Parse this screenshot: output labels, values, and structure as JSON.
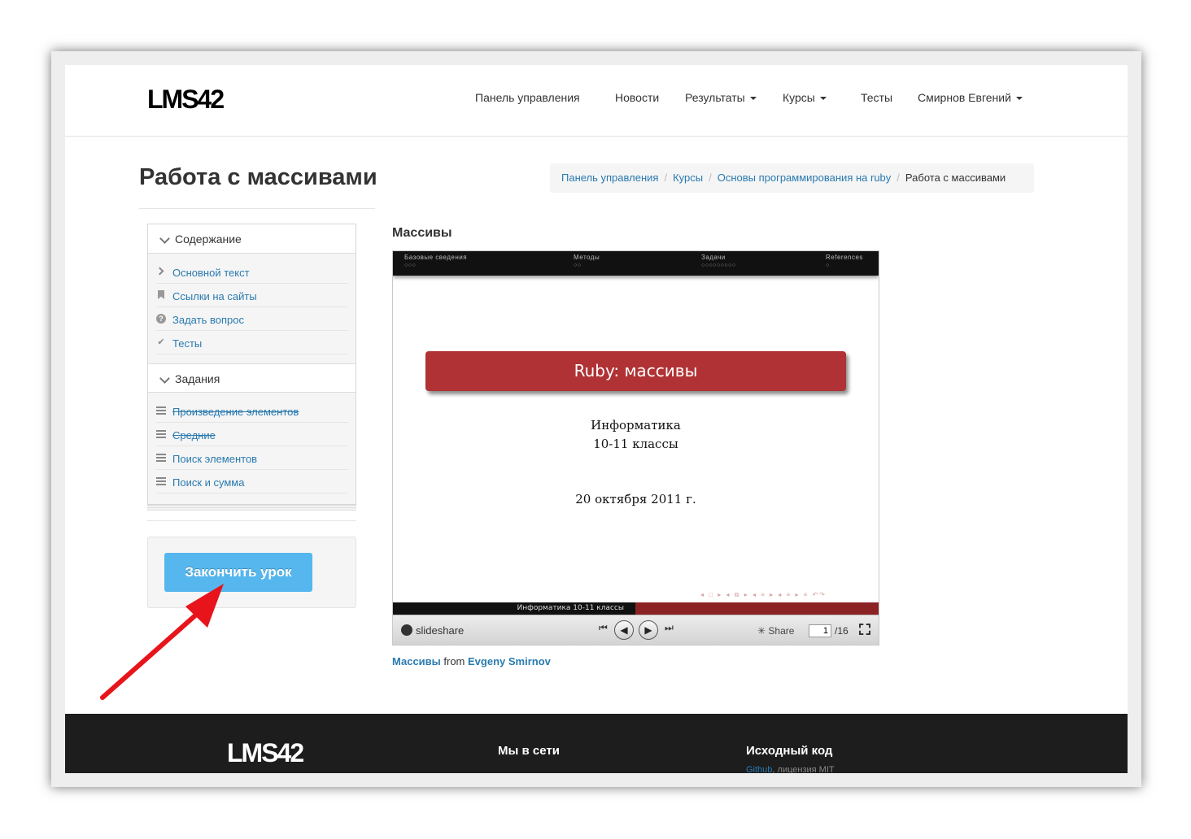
{
  "navbar": {
    "brand": "LMS42",
    "items": [
      {
        "label": "Панель управления",
        "dropdown": false
      },
      {
        "label": "Новости",
        "dropdown": false
      },
      {
        "label": "Результаты",
        "dropdown": true
      },
      {
        "label": "Курсы",
        "dropdown": true
      },
      {
        "label": "Тесты",
        "dropdown": false
      },
      {
        "label": "Смирнов Евгений",
        "dropdown": true
      }
    ]
  },
  "page_title": "Работа с массивами",
  "breadcrumb": {
    "items": [
      "Панель управления",
      "Курсы",
      "Основы программирования на ruby"
    ],
    "active": "Работа с массивами",
    "separator": "/"
  },
  "sidebar": {
    "contents_heading": "Содержание",
    "contents_items": [
      {
        "label": "Основной текст",
        "icon": "chevron-right-icon"
      },
      {
        "label": "Ссылки на сайты",
        "icon": "bookmark-icon"
      },
      {
        "label": "Задать вопрос",
        "icon": "question-circle-icon"
      },
      {
        "label": "Тесты",
        "icon": "check-icon"
      }
    ],
    "tasks_heading": "Задания",
    "tasks_items": [
      {
        "label": "Произведение элементов",
        "completed": true
      },
      {
        "label": "Средние",
        "completed": true
      },
      {
        "label": "Поиск элементов",
        "completed": false
      },
      {
        "label": "Поиск и сумма",
        "completed": false
      }
    ],
    "finish_button": "Закончить урок"
  },
  "main": {
    "heading": "Массивы",
    "slide": {
      "topbar_sections": [
        {
          "title": "Базовые сведения",
          "dots": "○○○"
        },
        {
          "title": "Методы",
          "dots": "○○"
        },
        {
          "title": "Задачи",
          "dots": "○○○○○○○○○"
        },
        {
          "title": "References",
          "dots": "○"
        }
      ],
      "title": "Ruby: массивы",
      "subject": "Информатика",
      "grades": "10-11 классы",
      "date": "20 октября 2011 г.",
      "nav_symbols": "◂ □ ▸  ◂ ⧉ ▸  ◂ ≡ ▸  ◂ ≡ ▸   ≡   ↶↷",
      "footer_text": "Информатика   10-11 классы"
    },
    "player": {
      "logo": "slideshare",
      "share_label": "Share",
      "current_page": "1",
      "total_pages": "/16"
    },
    "caption": {
      "title": "Массивы",
      "from": "from",
      "author": "Evgeny Smirnov"
    }
  },
  "footer": {
    "brand": "LMS42",
    "social_heading": "Мы в сети",
    "source_heading": "Исходный код",
    "source_link": "Github",
    "license_text": ", лицензия MIT"
  },
  "colors": {
    "accent_blue": "#55b7ee",
    "link_blue": "#2a7ab0",
    "slide_red": "#b03234",
    "annotation_arrow": "#e8141b"
  }
}
